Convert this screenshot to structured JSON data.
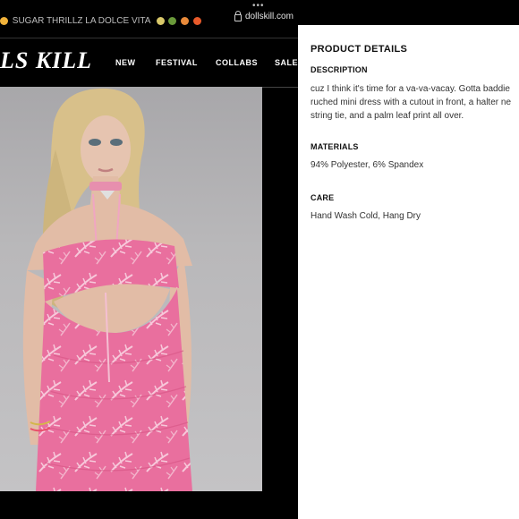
{
  "browser": {
    "url": "dollskill.com"
  },
  "promo": {
    "text": "SUGAR THRILLZ LA DOLCE VITA"
  },
  "header": {
    "logo": "LS KILL",
    "nav": [
      "NEW",
      "FESTIVAL",
      "COLLABS",
      "SALE"
    ]
  },
  "details": {
    "title": "PRODUCT DETAILS",
    "description_label": "DESCRIPTION",
    "description_lines": [
      "cuz I think it's time for a va-va-vacay. Gotta baddie",
      "ruched mini dress with a cutout in front, a halter ne",
      "string tie, and a palm leaf print all over."
    ],
    "materials_label": "MATERIALS",
    "materials": "94% Polyester, 6% Spandex",
    "care_label": "CARE",
    "care": "Hand Wash Cold, Hang Dry"
  },
  "colors": {
    "dress_pink": "#e96f9e",
    "print_light": "#f7c8da",
    "background_gray": "#b5b4b6"
  }
}
